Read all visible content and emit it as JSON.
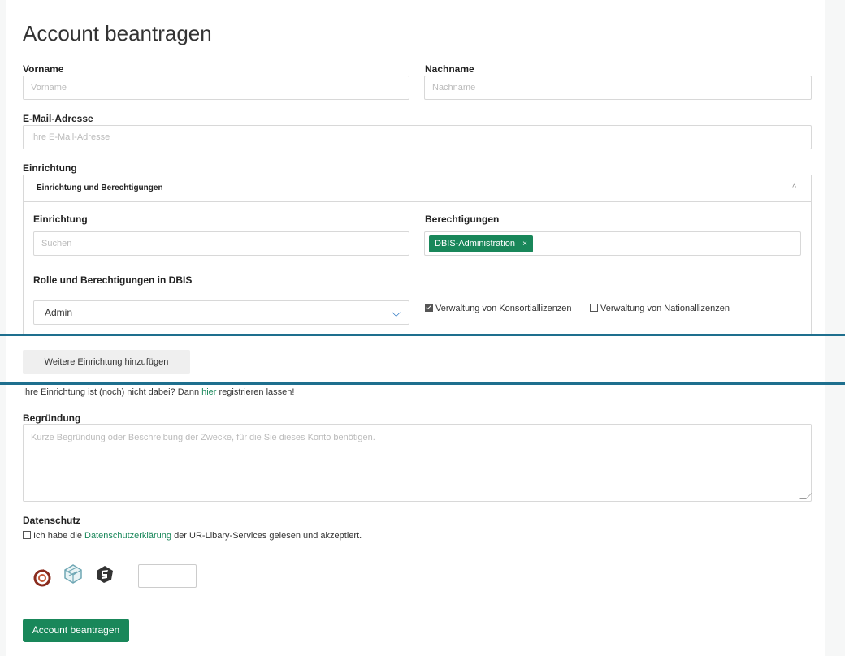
{
  "title": "Account beantragen",
  "fields": {
    "vorname": {
      "label": "Vorname",
      "placeholder": "Vorname"
    },
    "nachname": {
      "label": "Nachname",
      "placeholder": "Nachname"
    },
    "email": {
      "label": "E-Mail-Adresse",
      "placeholder": "Ihre E-Mail-Adresse"
    }
  },
  "einrichtung": {
    "section_label": "Einrichtung",
    "panel_title": "Einrichtung und Berechtigungen",
    "einrichtung_label": "Einrichtung",
    "search_placeholder": "Suchen",
    "berechtigungen_label": "Berechtigungen",
    "tag": "DBIS-Administration",
    "tag_remove": "×",
    "rolle_label": "Rolle und Berechtigungen in DBIS",
    "rolle_value": "Admin",
    "chevron_up": "^",
    "chevron_down": "⌵",
    "checkbox1": {
      "label": "Verwaltung von Konsortiallizenzen",
      "checked": true
    },
    "checkbox2": {
      "label": "Verwaltung von Nationallizenzen",
      "checked": false
    }
  },
  "add_button": "Weitere Einrichtung hinzufügen",
  "register_note": {
    "before": "Ihre Einrichtung ist (noch) nicht dabei? Dann ",
    "link": "hier",
    "after": " registrieren lassen!"
  },
  "begruendung": {
    "label": "Begründung",
    "placeholder": "Kurze Begründung oder Beschreibung der Zwecke, für die Sie dieses Konto benötigen."
  },
  "datenschutz": {
    "label": "Datenschutz",
    "before": "Ich habe die ",
    "link": "Datenschutzerklärung",
    "after": " der UR-Libary-Services gelesen und akzeptiert.",
    "checked": false
  },
  "captcha": {
    "icons": [
      "captcha-glyph-1-icon",
      "captcha-glyph-2-icon",
      "captcha-glyph-3-icon"
    ]
  },
  "submit_button": "Account beantragen",
  "colors": {
    "accent": "#19875a",
    "divider": "#1e6f8e"
  }
}
